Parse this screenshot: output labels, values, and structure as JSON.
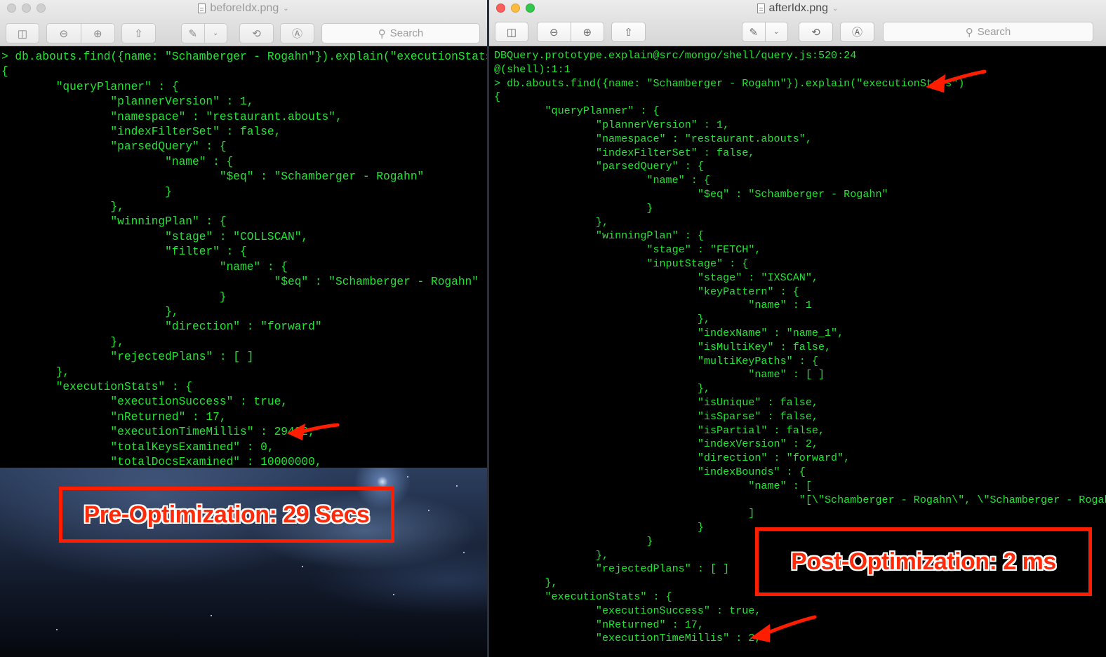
{
  "left_window": {
    "title": "beforeIdx.png",
    "search_placeholder": "Search",
    "terminal_lines": [
      "> db.abouts.find({name: \"Schamberger - Rogahn\"}).explain(\"executionStats\")",
      "{",
      "        \"queryPlanner\" : {",
      "                \"plannerVersion\" : 1,",
      "                \"namespace\" : \"restaurant.abouts\",",
      "                \"indexFilterSet\" : false,",
      "                \"parsedQuery\" : {",
      "                        \"name\" : {",
      "                                \"$eq\" : \"Schamberger - Rogahn\"",
      "                        }",
      "                },",
      "                \"winningPlan\" : {",
      "                        \"stage\" : \"COLLSCAN\",",
      "                        \"filter\" : {",
      "                                \"name\" : {",
      "                                        \"$eq\" : \"Schamberger - Rogahn\"",
      "                                }",
      "                        },",
      "                        \"direction\" : \"forward\"",
      "                },",
      "                \"rejectedPlans\" : [ ]",
      "        },",
      "        \"executionStats\" : {",
      "                \"executionSuccess\" : true,",
      "                \"nReturned\" : 17,",
      "                \"executionTimeMillis\" : 29432,",
      "                \"totalKeysExamined\" : 0,",
      "                \"totalDocsExamined\" : 10000000,"
    ],
    "annotation": "Pre-Optimization: 29 Secs"
  },
  "right_window": {
    "title": "afterIdx.png",
    "search_placeholder": "Search",
    "terminal_lines": [
      "DBQuery.prototype.explain@src/mongo/shell/query.js:520:24",
      "@(shell):1:1",
      "> db.abouts.find({name: \"Schamberger - Rogahn\"}).explain(\"executionStats\")",
      "{",
      "        \"queryPlanner\" : {",
      "                \"plannerVersion\" : 1,",
      "                \"namespace\" : \"restaurant.abouts\",",
      "                \"indexFilterSet\" : false,",
      "                \"parsedQuery\" : {",
      "                        \"name\" : {",
      "                                \"$eq\" : \"Schamberger - Rogahn\"",
      "                        }",
      "                },",
      "                \"winningPlan\" : {",
      "                        \"stage\" : \"FETCH\",",
      "                        \"inputStage\" : {",
      "                                \"stage\" : \"IXSCAN\",",
      "                                \"keyPattern\" : {",
      "                                        \"name\" : 1",
      "                                },",
      "                                \"indexName\" : \"name_1\",",
      "                                \"isMultiKey\" : false,",
      "                                \"multiKeyPaths\" : {",
      "                                        \"name\" : [ ]",
      "                                },",
      "                                \"isUnique\" : false,",
      "                                \"isSparse\" : false,",
      "                                \"isPartial\" : false,",
      "                                \"indexVersion\" : 2,",
      "                                \"direction\" : \"forward\",",
      "                                \"indexBounds\" : {",
      "                                        \"name\" : [",
      "                                                \"[\\\"Schamberger - Rogahn\\\", \\\"Schamberger - Rogahn\\\"]\"",
      "                                        ]",
      "                                }",
      "                        }",
      "                },",
      "                \"rejectedPlans\" : [ ]",
      "        },",
      "        \"executionStats\" : {",
      "                \"executionSuccess\" : true,",
      "                \"nReturned\" : 17,",
      "                \"executionTimeMillis\" : 2,"
    ],
    "annotation": "Post-Optimization: 2 ms"
  },
  "colors": {
    "terminal_text": "#23e533",
    "annotation_red": "#ff1d00"
  }
}
